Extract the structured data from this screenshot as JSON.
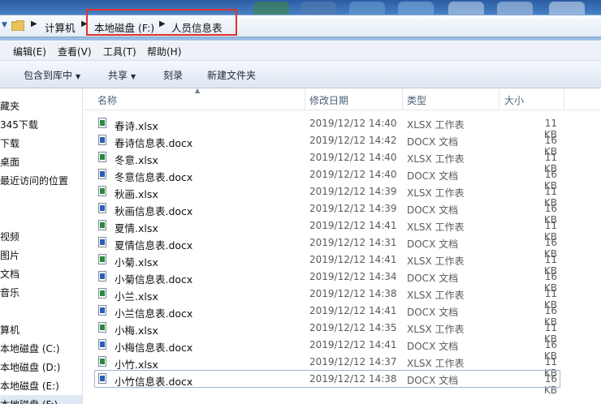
{
  "address": {
    "crumbs": [
      "计算机",
      "本地磁盘 (F:)",
      "人员信息表"
    ]
  },
  "menu": [
    "编辑(E)",
    "查看(V)",
    "工具(T)",
    "帮助(H)"
  ],
  "toolbar": {
    "include_library": "包含到库中",
    "share": "共享",
    "burn": "刻录",
    "new_folder": "新建文件夹"
  },
  "nav": [
    "藏夹",
    "345下载",
    "下载",
    "桌面",
    "最近访问的位置",
    "视频",
    "图片",
    "文档",
    "音乐",
    "算机",
    "本地磁盘 (C:)",
    "本地磁盘 (D:)",
    "本地磁盘 (E:)",
    "本地磁盘 (F:)"
  ],
  "columns": {
    "name": "名称",
    "modified": "修改日期",
    "type": "类型",
    "size": "大小"
  },
  "files": [
    {
      "name": "春诗.xlsx",
      "date": "2019/12/12 14:40",
      "type": "XLSX 工作表",
      "size": "11 KB",
      "kind": "xlsx"
    },
    {
      "name": "春诗信息表.docx",
      "date": "2019/12/12 14:42",
      "type": "DOCX 文档",
      "size": "16 KB",
      "kind": "docx"
    },
    {
      "name": "冬意.xlsx",
      "date": "2019/12/12 14:40",
      "type": "XLSX 工作表",
      "size": "11 KB",
      "kind": "xlsx"
    },
    {
      "name": "冬意信息表.docx",
      "date": "2019/12/12 14:40",
      "type": "DOCX 文档",
      "size": "16 KB",
      "kind": "docx"
    },
    {
      "name": "秋画.xlsx",
      "date": "2019/12/12 14:39",
      "type": "XLSX 工作表",
      "size": "11 KB",
      "kind": "xlsx"
    },
    {
      "name": "秋画信息表.docx",
      "date": "2019/12/12 14:39",
      "type": "DOCX 文档",
      "size": "16 KB",
      "kind": "docx"
    },
    {
      "name": "夏情.xlsx",
      "date": "2019/12/12 14:41",
      "type": "XLSX 工作表",
      "size": "11 KB",
      "kind": "xlsx"
    },
    {
      "name": "夏情信息表.docx",
      "date": "2019/12/12 14:31",
      "type": "DOCX 文档",
      "size": "16 KB",
      "kind": "docx"
    },
    {
      "name": "小菊.xlsx",
      "date": "2019/12/12 14:41",
      "type": "XLSX 工作表",
      "size": "11 KB",
      "kind": "xlsx"
    },
    {
      "name": "小菊信息表.docx",
      "date": "2019/12/12 14:34",
      "type": "DOCX 文档",
      "size": "16 KB",
      "kind": "docx"
    },
    {
      "name": "小兰.xlsx",
      "date": "2019/12/12 14:38",
      "type": "XLSX 工作表",
      "size": "11 KB",
      "kind": "xlsx"
    },
    {
      "name": "小兰信息表.docx",
      "date": "2019/12/12 14:41",
      "type": "DOCX 文档",
      "size": "16 KB",
      "kind": "docx"
    },
    {
      "name": "小梅.xlsx",
      "date": "2019/12/12 14:35",
      "type": "XLSX 工作表",
      "size": "11 KB",
      "kind": "xlsx"
    },
    {
      "name": "小梅信息表.docx",
      "date": "2019/12/12 14:41",
      "type": "DOCX 文档",
      "size": "16 KB",
      "kind": "docx"
    },
    {
      "name": "小竹.xlsx",
      "date": "2019/12/12 14:37",
      "type": "XLSX 工作表",
      "size": "11 KB",
      "kind": "xlsx"
    },
    {
      "name": "小竹信息表.docx",
      "date": "2019/12/12 14:38",
      "type": "DOCX 文档",
      "size": "16 KB",
      "kind": "docx"
    }
  ],
  "colors": {
    "xlsx_icon": "#2a8a3a",
    "docx_icon": "#2b5fb8",
    "highlight": "#e0322c"
  }
}
